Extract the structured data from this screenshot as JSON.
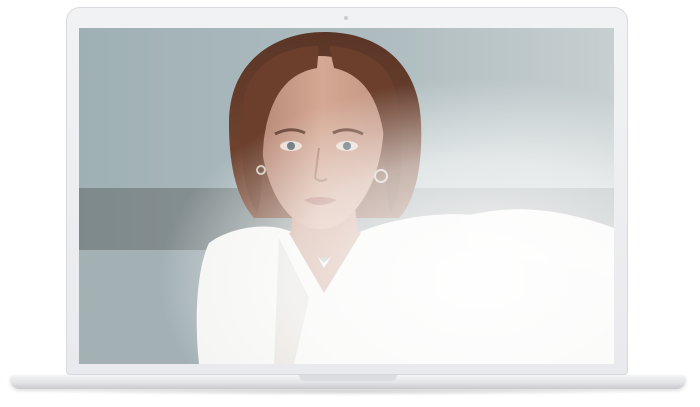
{
  "device": {
    "type": "laptop",
    "color": "#eceef0"
  },
  "screen_image": {
    "subject": "portrait photo",
    "palette": {
      "wall": "#a9b7bb",
      "band": "#8d989a",
      "hair": "#6b3f2c",
      "skin": "#cfa08c",
      "shirt": "#f4f4f2"
    }
  }
}
